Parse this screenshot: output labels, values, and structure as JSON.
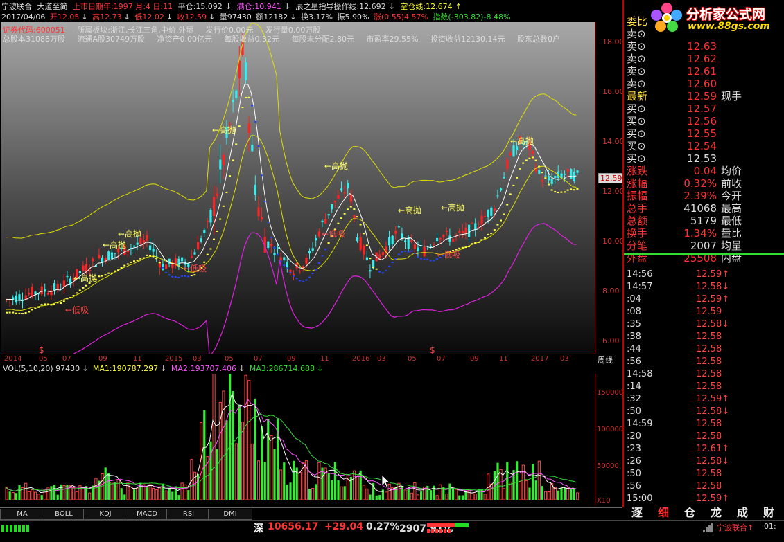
{
  "title_bar": {
    "stock": "宁波联合",
    "indicator": "大道至简",
    "listing": "上市日期年:1997 月:4 日:11",
    "flat_pos": "平仓:15.092",
    "full_pos": "满仓:10.941",
    "guide": "辰之星指导操作线:12.692",
    "empty_pos": "空仓线:12.674"
  },
  "ohlc": {
    "date": "2017/04/06",
    "open": "开12.05",
    "high": "高12.73",
    "low": "低12.02",
    "close": "收12.59",
    "vol": "量97430",
    "amount": "额12182",
    "turnover": "换3.17%",
    "amplitude": "振5.90%",
    "change": "涨(0.55)4.57%",
    "index": "指数(-303.82)-8.48%"
  },
  "info": {
    "code": "证券代码:600051",
    "sector": "所属板块:浙江,长江三角,中价,外贸",
    "issue_price": "发行价0.00元",
    "issue_vol": "发行量0.00万股",
    "total_shares": "总股本31088万股",
    "float_shares": "流通A股30749万股",
    "net_assets": "净资产0.00亿元",
    "eps": "每股收益0.32元",
    "undistributed": "每股未分配2.80元",
    "pe": "市盈率29.55%",
    "invest_income": "投资收益12130.14元",
    "holders": "股东总数0户"
  },
  "price_axis": [
    "18.00",
    "16.00",
    "14.00",
    "12.00",
    "10.00",
    "8.00",
    "6.00"
  ],
  "current_price_tag": "12.59",
  "date_axis": [
    "2014",
    "05",
    "07",
    "09",
    "11",
    "2015",
    "03",
    "05",
    "07",
    "09",
    "11",
    "2016",
    "03",
    "05",
    "07",
    "09",
    "11",
    "2017",
    "03"
  ],
  "period": "周线",
  "annotations": {
    "high_sell": "高抛",
    "low_buy": "低吸",
    "dollar": "$"
  },
  "vol_header": {
    "vol": "VOL(5,10,20) 97430",
    "ma1": "MA1:190787.297",
    "ma2": "MA2:193707.406",
    "ma3": "MA3:286714.688"
  },
  "vol_axis": [
    "150000",
    "100000",
    "50000",
    "X10"
  ],
  "tabs": [
    "MA",
    "BOLL",
    "KDJ",
    "MACD",
    "RSI",
    "DMI"
  ],
  "quote": {
    "header": "委比",
    "sells": [
      {
        "label": "卖⊙",
        "price": ""
      },
      {
        "label": "卖⊙",
        "price": "12.63"
      },
      {
        "label": "卖⊙",
        "price": "12.62"
      },
      {
        "label": "卖⊙",
        "price": "12.61"
      },
      {
        "label": "卖⊙",
        "price": "12.60"
      }
    ],
    "latest": {
      "label": "最新",
      "price": "12.59",
      "extra": "现手"
    },
    "buys": [
      {
        "label": "买⊙",
        "price": "12.57"
      },
      {
        "label": "买⊙",
        "price": "12.56"
      },
      {
        "label": "买⊙",
        "price": "12.55"
      },
      {
        "label": "买⊙",
        "price": "12.54"
      },
      {
        "label": "买⊙",
        "price": "12.53"
      }
    ],
    "stats": [
      {
        "label": "涨跌",
        "value": "0.04",
        "label2": "均价"
      },
      {
        "label": "涨幅",
        "value": "0.32%",
        "label2": "前收"
      },
      {
        "label": "振幅",
        "value": "2.39%",
        "label2": "今开"
      },
      {
        "label": "总手",
        "value": "41068",
        "label2": "最高"
      },
      {
        "label": "总额",
        "value": "5179",
        "label2": "最低"
      },
      {
        "label": "换手",
        "value": "1.34%",
        "label2": "量比"
      },
      {
        "label": "分笔",
        "value": "2007",
        "label2": "均量"
      },
      {
        "label": "外盘",
        "value": "25508",
        "label2": "内盘"
      }
    ],
    "ticks": [
      {
        "time": "14:56",
        "price": "12.59↑"
      },
      {
        "time": "14:57",
        "price": "12.58↓"
      },
      {
        "time": ":04",
        "price": "12.59↑"
      },
      {
        "time": ":08",
        "price": "12.59"
      },
      {
        "time": ":35",
        "price": "12.58↓"
      },
      {
        "time": ":38",
        "price": "12.58"
      },
      {
        "time": ":44",
        "price": "12.58"
      },
      {
        "time": ":56",
        "price": "12.58"
      },
      {
        "time": "14:58",
        "price": "12.58"
      },
      {
        "time": ":14",
        "price": "12.58"
      },
      {
        "time": ":32",
        "price": "12.59↑"
      },
      {
        "time": ":50",
        "price": "12.58↓"
      },
      {
        "time": "14:59",
        "price": "12.58"
      },
      {
        "time": ":20",
        "price": "12.58"
      },
      {
        "time": ":23",
        "price": "12.61↑"
      },
      {
        "time": ":26",
        "price": "12.58↓"
      },
      {
        "time": ":50",
        "price": "12.58"
      },
      {
        "time": ":56",
        "price": "12.58"
      },
      {
        "time": "15:00",
        "price": "12.59↑"
      }
    ],
    "nav": [
      "逐",
      "细",
      "仓",
      "龙",
      "成",
      "财"
    ]
  },
  "logo": {
    "name": "分析家公式网",
    "url": "www.88gs.com"
  },
  "status": {
    "market": "深",
    "index": "10656.17",
    "change": "+29.04",
    "pct": "0.27%",
    "amount": "2907.91亿",
    "ticker": "宁波联合↑",
    "time": "01:"
  },
  "colors": {
    "up": "#ff3333",
    "down": "#55ffff",
    "ma_white": "#ffffff",
    "band_yellow": "#e0e000",
    "band_magenta": "#e020e0",
    "axis": "#bb0000"
  }
}
